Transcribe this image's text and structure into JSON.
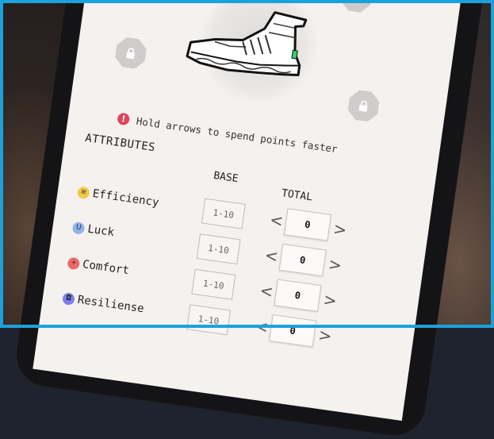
{
  "hint": {
    "icon": "!",
    "text": "Hold arrows to spend points faster"
  },
  "attributes": {
    "title": "ATTRIBUTES",
    "base_header": "BASE",
    "total_header": "TOTAL",
    "items": [
      {
        "name": "Efficiency",
        "icon": "efficiency-icon",
        "icon_glyph": "≡",
        "color": "#f2c94c",
        "base": "1-10",
        "total": "0"
      },
      {
        "name": "Luck",
        "icon": "luck-icon",
        "icon_glyph": "U",
        "color": "#8fb3e8",
        "base": "1-10",
        "total": "0"
      },
      {
        "name": "Comfort",
        "icon": "comfort-icon",
        "icon_glyph": "+",
        "color": "#ec6a6a",
        "base": "1-10",
        "total": "0"
      },
      {
        "name": "Resiliense",
        "icon": "resilience-icon",
        "icon_glyph": "◘",
        "color": "#7b7ff0",
        "base": "1-10",
        "total": "0"
      }
    ]
  },
  "colors": {
    "screen_bg": "#f4f1ef",
    "frame": "#1da1dc",
    "alert": "#e0445c",
    "accent_green": "#2dd36f"
  }
}
